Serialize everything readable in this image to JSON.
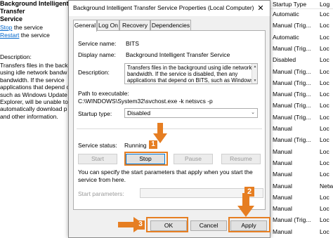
{
  "left_panel": {
    "title_line1": "Background Intelligent Transfer",
    "title_line2": "Service",
    "stop_link": "Stop",
    "stop_suffix": " the service",
    "restart_link": "Restart",
    "restart_suffix": " the service",
    "description_label": "Description:",
    "description_lines": "Transfers files in the background\nusing idle network bandw\nbandwidth. If the service\napplications that depend o\nsuch as Windows Update\nExplorer, will be unable to\nautomatically download p\nand other information."
  },
  "right_panel": {
    "columns": [
      "Startup Type",
      "Log"
    ],
    "rows": [
      {
        "startup": "Automatic",
        "log": "Loc"
      },
      {
        "startup": "Manual (Trig...",
        "log": "Loc"
      },
      {
        "startup": "Automatic",
        "log": "Loc"
      },
      {
        "startup": "Manual (Trig...",
        "log": "Loc"
      },
      {
        "startup": "Disabled",
        "log": "Loc"
      },
      {
        "startup": "Manual (Trig...",
        "log": "Loc"
      },
      {
        "startup": "Manual (Trig...",
        "log": "Loc"
      },
      {
        "startup": "Manual (Trig...",
        "log": "Loc"
      },
      {
        "startup": "Manual (Trig...",
        "log": "Loc"
      },
      {
        "startup": "Manual (Trig...",
        "log": "Loc"
      },
      {
        "startup": "Manual",
        "log": "Loc"
      },
      {
        "startup": "Manual (Trig...",
        "log": "Loc"
      },
      {
        "startup": "Manual",
        "log": "Loc"
      },
      {
        "startup": "Manual",
        "log": "Loc"
      },
      {
        "startup": "Manual",
        "log": "Loc"
      },
      {
        "startup": "Manual",
        "log": "Netw"
      },
      {
        "startup": "Manual",
        "log": "Loc"
      },
      {
        "startup": "Manual",
        "log": "Loc"
      },
      {
        "startup": "Manual (Trig...",
        "log": "Loc"
      },
      {
        "startup": "Manual",
        "log": "Loc"
      }
    ]
  },
  "dialog": {
    "title": "Background Intelligent Transfer Service Properties (Local Computer)",
    "close_glyph": "✕",
    "tabs": [
      "General",
      "Log On",
      "Recovery",
      "Dependencies"
    ],
    "service_name_label": "Service name:",
    "service_name": "BITS",
    "display_name_label": "Display name:",
    "display_name": "Background Intelligent Transfer Service",
    "description_label": "Description:",
    "description": "Transfers files in the background using idle network bandwidth. If the service is disabled, then any applications that depend on BITS, such as Windows",
    "path_label": "Path to executable:",
    "path": "C:\\WINDOWS\\System32\\svchost.exe -k netsvcs -p",
    "startup_type_label": "Startup type:",
    "startup_type": "Disabled",
    "service_status_label": "Service status:",
    "service_status": "Running",
    "buttons": {
      "start": "Start",
      "stop": "Stop",
      "pause": "Pause",
      "resume": "Resume"
    },
    "note": "You can specify the start parameters that apply when you start the service from here.",
    "start_params_label": "Start parameters:",
    "start_params_value": "",
    "footer": {
      "ok": "OK",
      "cancel": "Cancel",
      "apply": "Apply"
    }
  },
  "annotations": {
    "accent_color": "#e67e22",
    "markers": [
      "1",
      "2",
      "3"
    ]
  }
}
